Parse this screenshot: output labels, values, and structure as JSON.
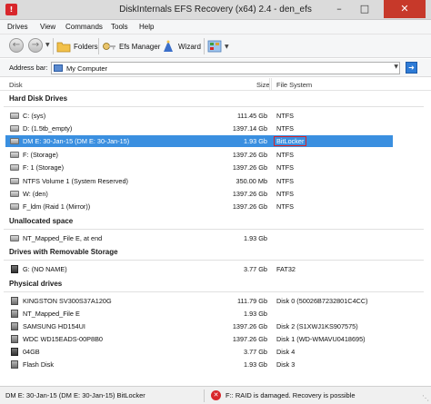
{
  "window": {
    "title": "DiskInternals EFS Recovery (x64) 2.4 - den_efs",
    "app_icon": "diskinternals-logo-icon",
    "controls": [
      "minimize-icon",
      "maximize-icon",
      "close-icon"
    ]
  },
  "menu": [
    "Drives",
    "View",
    "Commands",
    "Tools",
    "Help"
  ],
  "toolbar": {
    "back_icon": "back-arrow-icon",
    "forward_icon": "forward-arrow-icon",
    "folders_label": "Folders",
    "efs_manager_label": "Efs Manager",
    "wizard_label": "Wizard",
    "view_icon": "view-mode-icon"
  },
  "address": {
    "label": "Address bar:",
    "value": "My Computer",
    "icon": "computer-icon",
    "go_icon": "go-icon"
  },
  "columns": {
    "disk": "Disk",
    "size": "Size",
    "filesystem": "File System"
  },
  "groups": {
    "hdd": "Hard Disk Drives",
    "unallocated": "Unallocated space",
    "removable": "Drives with Removable Storage",
    "physical": "Physical drives"
  },
  "hdd_rows": [
    {
      "name": "C: (sys)",
      "size": "111.45 Gb",
      "fs": "NTFS"
    },
    {
      "name": "D: (1.5tb_empty)",
      "size": "1397.14 Gb",
      "fs": "NTFS"
    },
    {
      "name": "DM E: 30-Jan-15 (DM E: 30-Jan-15)",
      "size": "1.93 Gb",
      "fs": "BitLocker"
    },
    {
      "name": "F: (Storage)",
      "size": "1397.26 Gb",
      "fs": "NTFS"
    },
    {
      "name": "F: 1 (Storage)",
      "size": "1397.26 Gb",
      "fs": "NTFS"
    },
    {
      "name": "NTFS Volume 1 (System Reserved)",
      "size": "350.00 Mb",
      "fs": "NTFS"
    },
    {
      "name": "W: (den)",
      "size": "1397.26 Gb",
      "fs": "NTFS"
    },
    {
      "name": "F_ldm (Raid 1 (Mirror))",
      "size": "1397.26 Gb",
      "fs": "NTFS"
    }
  ],
  "unallocated_rows": [
    {
      "name": "NT_Mapped_File E, at end",
      "size": "1.93 Gb",
      "fs": ""
    }
  ],
  "removable_rows": [
    {
      "name": "G: (NO NAME)",
      "size": "3.77 Gb",
      "fs": "FAT32"
    }
  ],
  "physical_rows": [
    {
      "name": "KINGSTON SV300S37A120G",
      "size": "111.79 Gb",
      "fs": "Disk 0 (50026B7232801C4CC)"
    },
    {
      "name": "NT_Mapped_File E",
      "size": "1.93 Gb",
      "fs": ""
    },
    {
      "name": "SAMSUNG HD154UI",
      "size": "1397.26 Gb",
      "fs": "Disk 2 (S1XWJ1KS907575)"
    },
    {
      "name": "WDC WD15EADS-00P8B0",
      "size": "1397.26 Gb",
      "fs": "Disk 1 (WD-WMAVU0418695)"
    },
    {
      "name": "04GB",
      "size": "3.77 Gb",
      "fs": "Disk 4"
    },
    {
      "name": "Flash Disk",
      "size": "1.93 Gb",
      "fs": "Disk 3"
    }
  ],
  "status": {
    "left": "DM E: 30-Jan-15 (DM E: 30-Jan-15) BitLocker",
    "error_icon": "error-icon",
    "right": "F:: RAID is damaged. Recovery is possible"
  },
  "colors": {
    "selection": "#3a8fe0",
    "highlight_box": "#d7242a",
    "close_button": "#c7392a"
  }
}
